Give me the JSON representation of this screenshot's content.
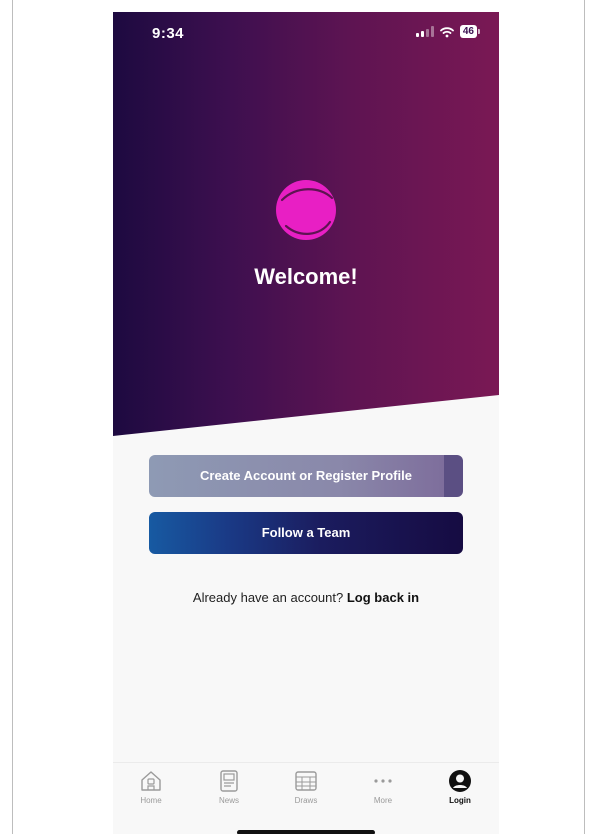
{
  "status_bar": {
    "time": "9:34",
    "battery": "46"
  },
  "hero": {
    "welcome": "Welcome!",
    "logo_icon": "brand-ball-icon",
    "brand_color": "#e81fc4"
  },
  "actions": {
    "create_account": "Create Account or Register Profile",
    "follow_team": "Follow a Team"
  },
  "login_prompt": {
    "text": "Already have an account?",
    "link": "Log back in"
  },
  "tabs": [
    {
      "label": "Home",
      "icon": "home-icon",
      "active": false
    },
    {
      "label": "News",
      "icon": "news-icon",
      "active": false
    },
    {
      "label": "Draws",
      "icon": "draws-icon",
      "active": false
    },
    {
      "label": "More",
      "icon": "more-icon",
      "active": false
    },
    {
      "label": "Login",
      "icon": "user-icon",
      "active": true
    }
  ]
}
